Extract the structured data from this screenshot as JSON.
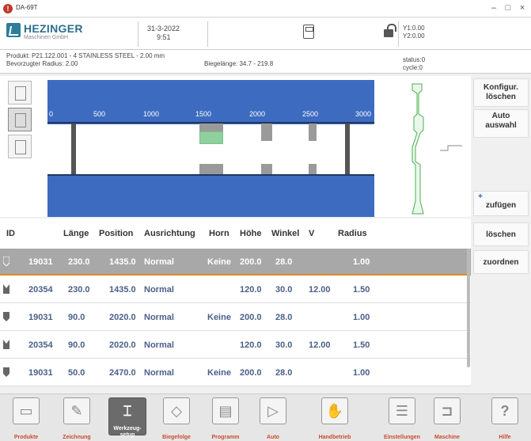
{
  "window": {
    "title": "DA-69T"
  },
  "header": {
    "brand": "HEZINGER",
    "brand_sub": "Maschinen GmbH",
    "date": "31-3-2022",
    "time": "9:51",
    "y1": "Y1:0.00",
    "y2": "Y2:0.00"
  },
  "info": {
    "product": "Produkt: P21.122.001 - 4 STAINLESS STEEL - 2.00 mm",
    "radius": "Bevorzugter Radius: 2.00",
    "bend_length": "Biegelänge: 34.7 - 219.8",
    "status": "status:0",
    "cycle": "cycle:0"
  },
  "scale": [
    "0",
    "500",
    "1000",
    "1500",
    "2000",
    "2500",
    "3000"
  ],
  "side": {
    "config_delete": "Konfigur.\nlöschen",
    "auto_select": "Auto\nauswahl",
    "add_plus": "+",
    "add": "zufügen",
    "delete": "löschen",
    "assign": "zuordnen"
  },
  "table": {
    "headers": [
      "ID",
      "Länge",
      "Position",
      "Ausrichtung",
      "Horn",
      "Höhe",
      "Winkel",
      "V",
      "Radius"
    ],
    "rows": [
      {
        "id": "19031",
        "len": "230.0",
        "pos": "1435.0",
        "align": "Normal",
        "horn": "Keine",
        "height": "200.0",
        "angle": "28.0",
        "v": "",
        "radius": "1.00"
      },
      {
        "id": "20354",
        "len": "230.0",
        "pos": "1435.0",
        "align": "Normal",
        "horn": "",
        "height": "120.0",
        "angle": "30.0",
        "v": "12.00",
        "radius": "1.50"
      },
      {
        "id": "19031",
        "len": "90.0",
        "pos": "2020.0",
        "align": "Normal",
        "horn": "Keine",
        "height": "200.0",
        "angle": "28.0",
        "v": "",
        "radius": "1.00"
      },
      {
        "id": "20354",
        "len": "90.0",
        "pos": "2020.0",
        "align": "Normal",
        "horn": "",
        "height": "120.0",
        "angle": "30.0",
        "v": "12.00",
        "radius": "1.50"
      },
      {
        "id": "19031",
        "len": "50.0",
        "pos": "2470.0",
        "align": "Normal",
        "horn": "Keine",
        "height": "200.0",
        "angle": "28.0",
        "v": "",
        "radius": "1.00"
      }
    ]
  },
  "nav": {
    "produkte": "Produkte",
    "zeichnung": "Zeichnung",
    "werkzeug": "Werkzeug-\nsetup",
    "biegefolge": "Biegefolge",
    "programm": "Programm",
    "auto": "Auto",
    "handbetrieb": "Handbetrieb",
    "einstellungen": "Einstellungen",
    "maschine": "Maschine",
    "hilfe": "Hilfe"
  }
}
